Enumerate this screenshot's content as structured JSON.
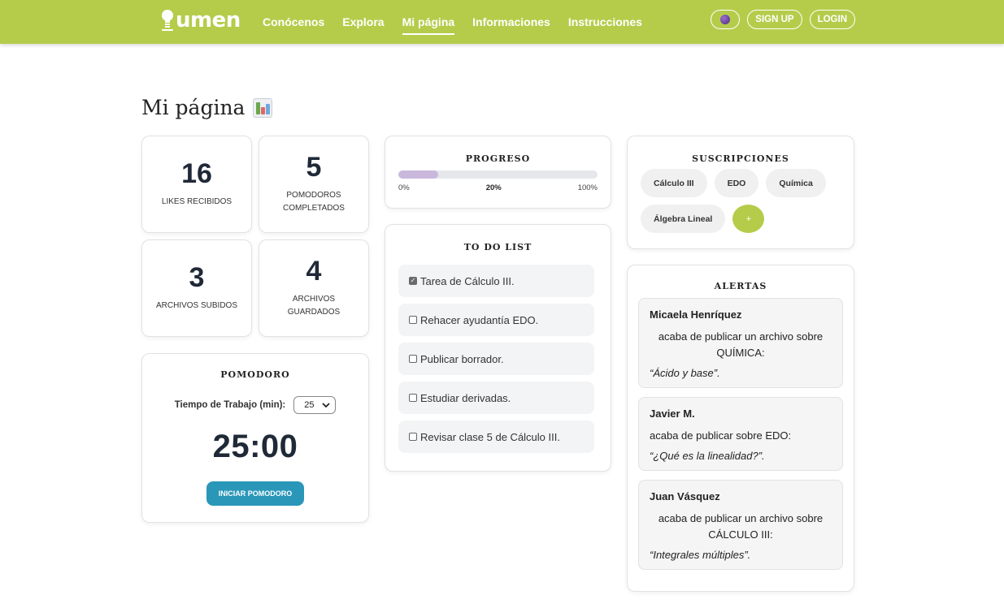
{
  "nav": {
    "logo_text": "umen",
    "links": [
      "Conócenos",
      "Explora",
      "Mi página",
      "Informaciones",
      "Instrucciones"
    ],
    "active": "Mi página",
    "signup": "SIGN UP",
    "login": "LOGIN"
  },
  "page_title": "Mi página",
  "stats": [
    {
      "value": "16",
      "label": "LIKES RECIBIDOS"
    },
    {
      "value": "5",
      "label": "POMODOROS COMPLETADOS"
    },
    {
      "value": "3",
      "label": "ARCHIVOS SUBIDOS"
    },
    {
      "value": "4",
      "label": "ARCHIVOS GUARDADOS"
    }
  ],
  "pomodoro": {
    "heading": "POMODORO",
    "label": "Tiempo de Trabajo (min):",
    "selected": "25",
    "time": "25:00",
    "button": "INICIAR POMODORO"
  },
  "progress": {
    "heading": "PROGRESO",
    "percent": 20,
    "min_label": "0%",
    "value_label": "20%",
    "max_label": "100%"
  },
  "todo": {
    "heading": "TO DO LIST",
    "items": [
      {
        "text": "Tarea de Cálculo III.",
        "checked": true
      },
      {
        "text": "Rehacer ayudantía EDO.",
        "checked": false
      },
      {
        "text": "Publicar borrador.",
        "checked": false
      },
      {
        "text": "Estudiar derivadas.",
        "checked": false
      },
      {
        "text": "Revisar clase 5 de Cálculo III.",
        "checked": false
      }
    ]
  },
  "subscriptions": {
    "heading": "SUSCRIPCIONES",
    "chips": [
      "Cálculo III",
      "EDO",
      "Química",
      "Álgebra Lineal"
    ],
    "add": "+"
  },
  "alerts": {
    "heading": "ALERTAS",
    "items": [
      {
        "name": "Micaela Henríquez",
        "msg": "acaba de publicar un archivo sobre QUÍMICA:",
        "title": "“Ácido y base”."
      },
      {
        "name": "Javier M.",
        "msg": "acaba de publicar sobre EDO:",
        "title": "“¿Qué es la linealidad?”."
      },
      {
        "name": "Juan Vásquez",
        "msg": "acaba de publicar un archivo sobre CÁLCULO III:",
        "title": "“Integrales múltiples”."
      }
    ]
  },
  "colors": {
    "brand": "#b5cc4b",
    "button": "#2a97b9",
    "progress": "#c9b8dc"
  }
}
